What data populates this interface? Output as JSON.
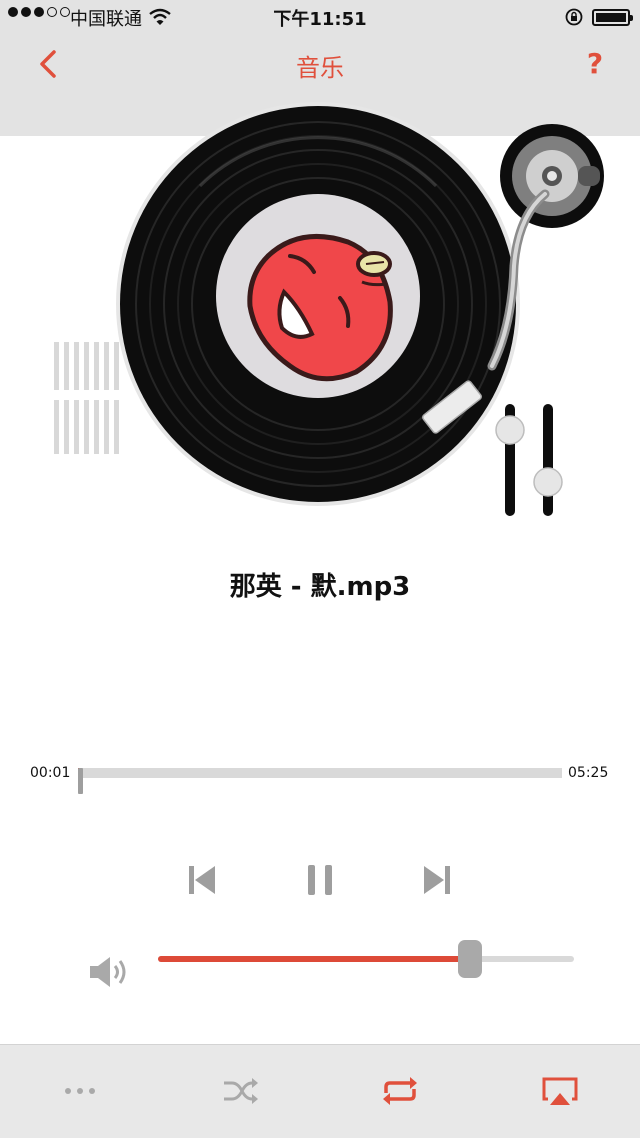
{
  "status_bar": {
    "carrier": "中国联通",
    "time": "下午11:51"
  },
  "nav": {
    "title": "音乐",
    "help_label": "?"
  },
  "player": {
    "song_title": "那英 - 默.mp3",
    "current_time": "00:01",
    "total_time": "05:25",
    "progress_fraction": 0.003,
    "volume_fraction": 0.75
  },
  "colors": {
    "accent": "#e0503c",
    "toolbar_bg": "#e8e8e8",
    "icon_gray": "#9e9e9e"
  },
  "toolbar": {
    "items": [
      "more-icon",
      "shuffle-icon",
      "repeat-icon",
      "airplay-icon"
    ]
  }
}
